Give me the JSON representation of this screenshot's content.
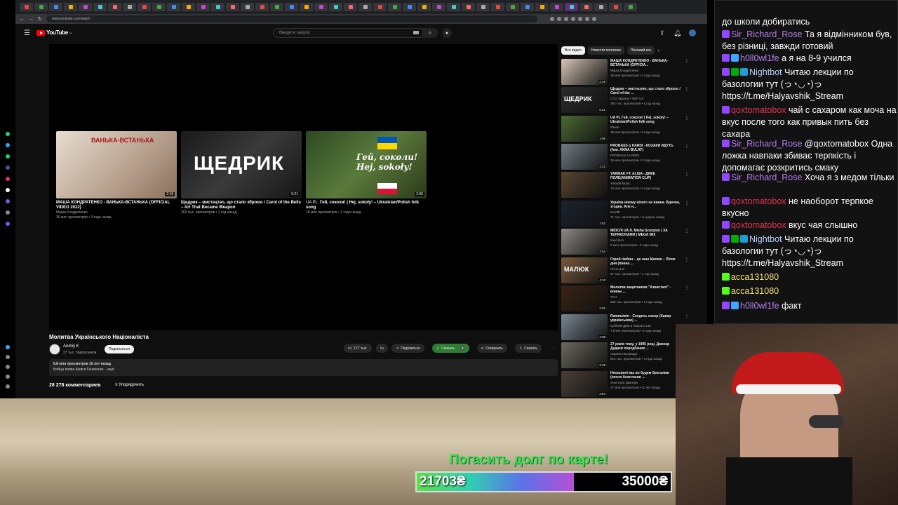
{
  "browser": {
    "url": "www.youtube.com/watch",
    "tab_labels": [
      "HO",
      "HO",
      "HO",
      "HO",
      "HO",
      "HO",
      "HO",
      "HO"
    ]
  },
  "youtube": {
    "logo": "YouTube",
    "logo_sup": "UA",
    "search_placeholder": "Введите запрос",
    "end_cards": [
      {
        "title": "МАША КОНДРАТЕНКО - ВАНЬКА-ВСТАНЬКА (OFFICIAL VIDEO 2022)",
        "channel": "Маша Кондратенко",
        "stats": "36 млн просмотров • 3 года назад",
        "duration": "2:16",
        "overlay": "ВАНЬКА-ВСТАНЬКА",
        "color": "#c9b8a8"
      },
      {
        "title": "Щедрик – мистецтво, що стало зброєю / Carol of the Bells – Art That Became Weapon",
        "channel": "ССО України / SOF UA",
        "stats": "363 тыс. просмотров • 1 год назад",
        "duration": "5:21",
        "overlay": "ЩЕДРИК",
        "color": "#2a2a2a"
      },
      {
        "title": "Гей, соколи! | Hej, sokoły! – Ukrainian/Polish folk song",
        "channel": "Eileen",
        "stats": "18 млн просмотров • 3 года назад",
        "duration": "3:06",
        "overlay": "Гей, соколи! Hej, sokoły!",
        "prefix": "UA PL",
        "color": "#3e5a2a"
      }
    ],
    "video_title": "Молитва Українського Націоналіста",
    "channel_name": "Andriy K",
    "channel_subs": "27 тыс. подписчиков",
    "subscribe_label": "Подписаться",
    "likes": "177 тыс.",
    "share_label": "Поделиться",
    "download_label": "Скачать",
    "save_label": "Сохранить",
    "download2_label": "Скачать",
    "views_date": "6,8 млн просмотров  10 лет назад",
    "description": "Бойцы полка Азов в Геническе ...ещё",
    "comments_count": "28 278 комментариев",
    "sort_label": "Упорядочить",
    "chips": [
      "Все видео",
      "Новости политики",
      "Похожий кон"
    ],
    "recommendations": [
      {
        "title": "МАША КОНДРАТЕНКО - ВАНЬКА-ВСТАНЬКА (OFFICIA...",
        "channel": "Маша Кондратенко",
        "stats": "36 млн просмотров • 3 года назад",
        "duration": "2:16",
        "color": "#d8c6b6"
      },
      {
        "title": "Щедрик – мистецтво, що стало зброєю / Carol of the ...",
        "channel": "ССО України / SOF UA",
        "stats": "363 тыс. просмотров • 1 год назад",
        "duration": "5:21",
        "color": "#2b2b2b",
        "overlay": "ЩЕДРИК"
      },
      {
        "title": "UA PL Гей, соколи! | Hej, sokoły! – Ukrainian/Polish folk song",
        "channel": "Eileen",
        "stats": "18 млн просмотров • 3 года назад",
        "duration": "3:06",
        "color": "#4b6a34"
      },
      {
        "title": "PROBASS ∆ HARDI - КОЗАКИ ЙДУТЬ (feat. ANNA BULAT)",
        "channel": "PROBASS ∆ HARDI",
        "stats": "15 млн просмотров • 3 года назад",
        "duration": "2:23",
        "color": "#6f7d86"
      },
      {
        "title": "YARMAK FT. ALISA - ДИКЕ ПОЛЕ(ANIMATION CLIP)",
        "channel": "Yarmak Music",
        "stats": "14 млн просмотров • 2 года назад",
        "duration": "",
        "color": "#5a4532"
      },
      {
        "title": "Україна нікому нічого не винна. Вдячна, згодна. Але н...",
        "channel": "МАЛІР",
        "stats": "71 тыс. просмотров • 3 недели назад",
        "duration": "2:53",
        "color": "#1c2430"
      },
      {
        "title": "МЮСЛІ UA ft. Misha Scorpion | ЗА ТЕРИКОНАМИ | MEGA MIX",
        "channel": "МюслiUA",
        "stats": "6 млн просмотров • 2 года назад",
        "duration": "2:54",
        "color": "#8d8b84"
      },
      {
        "title": "Герой гімбин – це наш Малюк – Пісня дня (повна ...",
        "channel": "Пісня дня",
        "stats": "87 тыс. просмотров • 1 год назад",
        "duration": "4:10",
        "color": "#7a5a3e",
        "overlay": "МАЛЮК"
      },
      {
        "title": "Молитва защитников \"Азовсталі\" - воины ...",
        "channel": "ТСН",
        "stats": "566 тыс. просмотров • 3 года назад",
        "duration": "2:02",
        "color": "#3a2414"
      },
      {
        "title": "Rammstein - Сходить сонце (Кавер українською) ...",
        "channel": "Срібний Двіж в Vanpum 140",
        "stats": "7,9 млн просмотров • 3 года назад",
        "duration": "4:38",
        "color": "#7a8894"
      },
      {
        "title": "27 років тому, у 1995 році, Джохар Дудаєв передбачив ...",
        "channel": "Україна насправді",
        "stats": "515 тыс. просмотров • 3 года назад",
        "duration": "2:28",
        "color": "#6b6a5e"
      },
      {
        "title": "Нескорені мы во будем братьями (песня Анастасии ...",
        "channel": "Анастасія Дмитрук",
        "stats": "27 млн просмотров • 11 лет назад",
        "duration": "3:54",
        "color": "#4a4038"
      }
    ]
  },
  "chat": {
    "messages": [
      {
        "user": "",
        "text": "до школи добиратись",
        "color": "#ffffff",
        "badges": []
      },
      {
        "user": "Sir_Richard_Rose",
        "text": "Та я відмінником був, без різниці, завжди готовий",
        "color": "#b57ef0",
        "badges": [
          "#9146ff"
        ]
      },
      {
        "user": "h0ll0wl1fe",
        "text": "а я на 8-9 учился",
        "color": "#b57ef0",
        "badges": [
          "#9146ff",
          "#3ea6ff"
        ]
      },
      {
        "user": "Nightbot",
        "text": "Читаю лекции по базологии тут (っ◔◡◔)っ https://t.me/Halyavshik_Stream",
        "color": "#b9d3ff",
        "badges": [
          "#9146ff",
          "#00ad03",
          "#1e9cd7"
        ]
      },
      {
        "user": "qoxtomatobox",
        "text": "чай с сахаром как моча на вкус после того как привык пить без сахара",
        "color": "#e0344f",
        "badges": [
          "#9146ff"
        ]
      },
      {
        "user": "Sir_Richard_Rose",
        "text": "@qoxtomatobox Одна ложка навпаки збиває терпкість і допомагає розкритись смаку",
        "color": "#b57ef0",
        "badges": [
          "#9146ff"
        ]
      },
      {
        "user": "Sir_Richard_Rose",
        "text": "Хоча я з медом тільки",
        "color": "#b57ef0",
        "badges": [
          "#9146ff"
        ]
      },
      {
        "user": "qoxtomatobox",
        "text": "не наоборот терпкое вкусно",
        "color": "#e0344f",
        "badges": [
          "#9146ff"
        ]
      },
      {
        "user": "qoxtomatobox",
        "text": "вкус чая слышно",
        "color": "#e0344f",
        "badges": [
          "#9146ff"
        ]
      },
      {
        "user": "Nightbot",
        "text": "Читаю лекции по базологии тут (っ◔◡◔)っ https://t.me/Halyavshik_Stream",
        "color": "#b9d3ff",
        "badges": [
          "#9146ff",
          "#00ad03",
          "#1e9cd7"
        ]
      },
      {
        "user": "acca131080",
        "text": "",
        "color": "#f6e27a",
        "badges": [
          "#53fc18"
        ]
      },
      {
        "user": "acca131080",
        "text": "",
        "color": "#f6e27a",
        "badges": [
          "#53fc18"
        ]
      },
      {
        "user": "h0ll0wl1fe",
        "text": "факт",
        "color": "#b57ef0",
        "badges": [
          "#9146ff",
          "#3ea6ff"
        ]
      }
    ]
  },
  "goal": {
    "title": "Погасить долг по карте!",
    "current": "21703₴",
    "target": "35000₴",
    "progress": 0.62
  }
}
